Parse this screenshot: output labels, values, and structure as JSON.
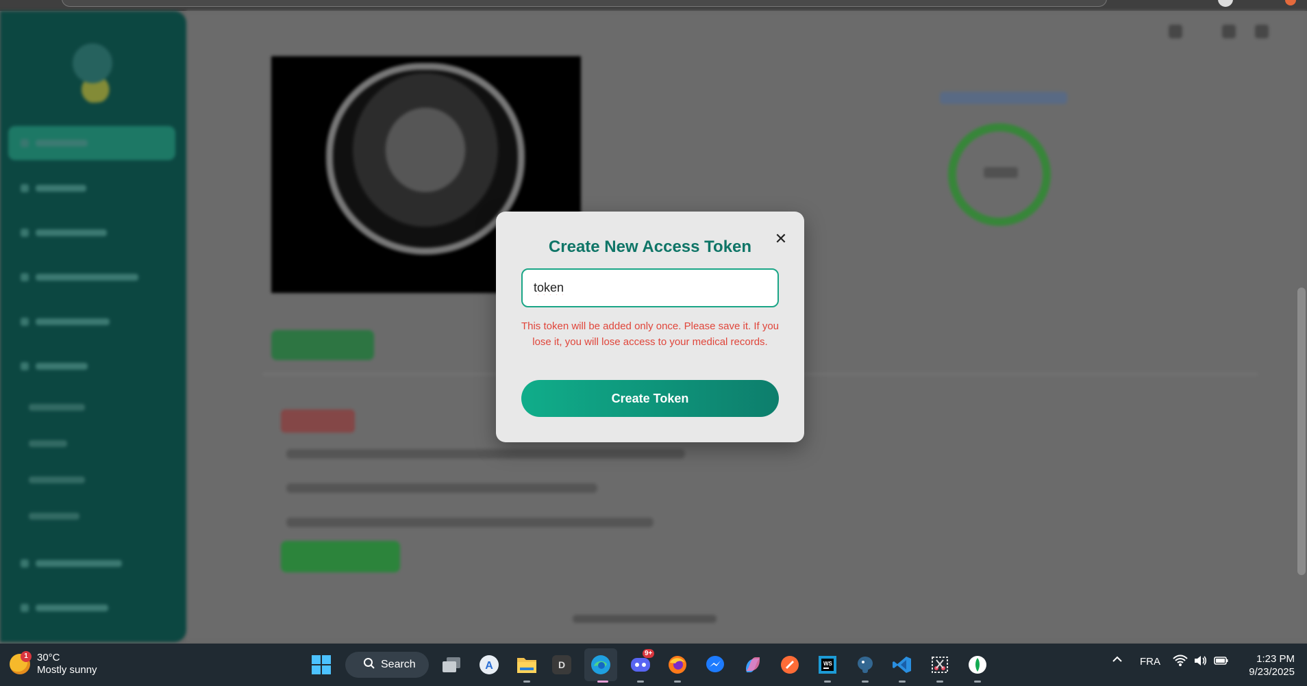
{
  "modal": {
    "title": "Create New Access Token",
    "close_symbol": "✕",
    "input_value": "token",
    "warning": "This token will be added only once. Please save it. If you lose it, you will lose access to your medical records.",
    "create_button_label": "Create Token"
  },
  "colors": {
    "modal_title": "#0f7567",
    "warning_text": "#e0453a",
    "button_gradient_start": "#10ad8a",
    "button_gradient_end": "#0d7e6c",
    "input_border": "#1aa586"
  },
  "taskbar": {
    "weather": {
      "badge": "1",
      "temperature": "30°C",
      "condition": "Mostly sunny"
    },
    "search_label": "Search",
    "discord_badge": "9+",
    "d_app_letter": "D",
    "language": "FRA",
    "time": "1:23 PM",
    "date": "9/23/2025",
    "icons": [
      "start-icon",
      "search-icon",
      "task-view-icon",
      "app-store-icon",
      "file-explorer-icon",
      "d-app-icon",
      "edge-icon",
      "discord-icon",
      "firefox-icon",
      "messenger-icon",
      "copilot-icon",
      "postman-icon",
      "webstorm-icon",
      "postgresql-icon",
      "vscode-icon",
      "snipping-tool-icon",
      "mongodb-icon",
      "chevron-up-icon",
      "wifi-icon",
      "volume-icon",
      "battery-icon"
    ]
  }
}
